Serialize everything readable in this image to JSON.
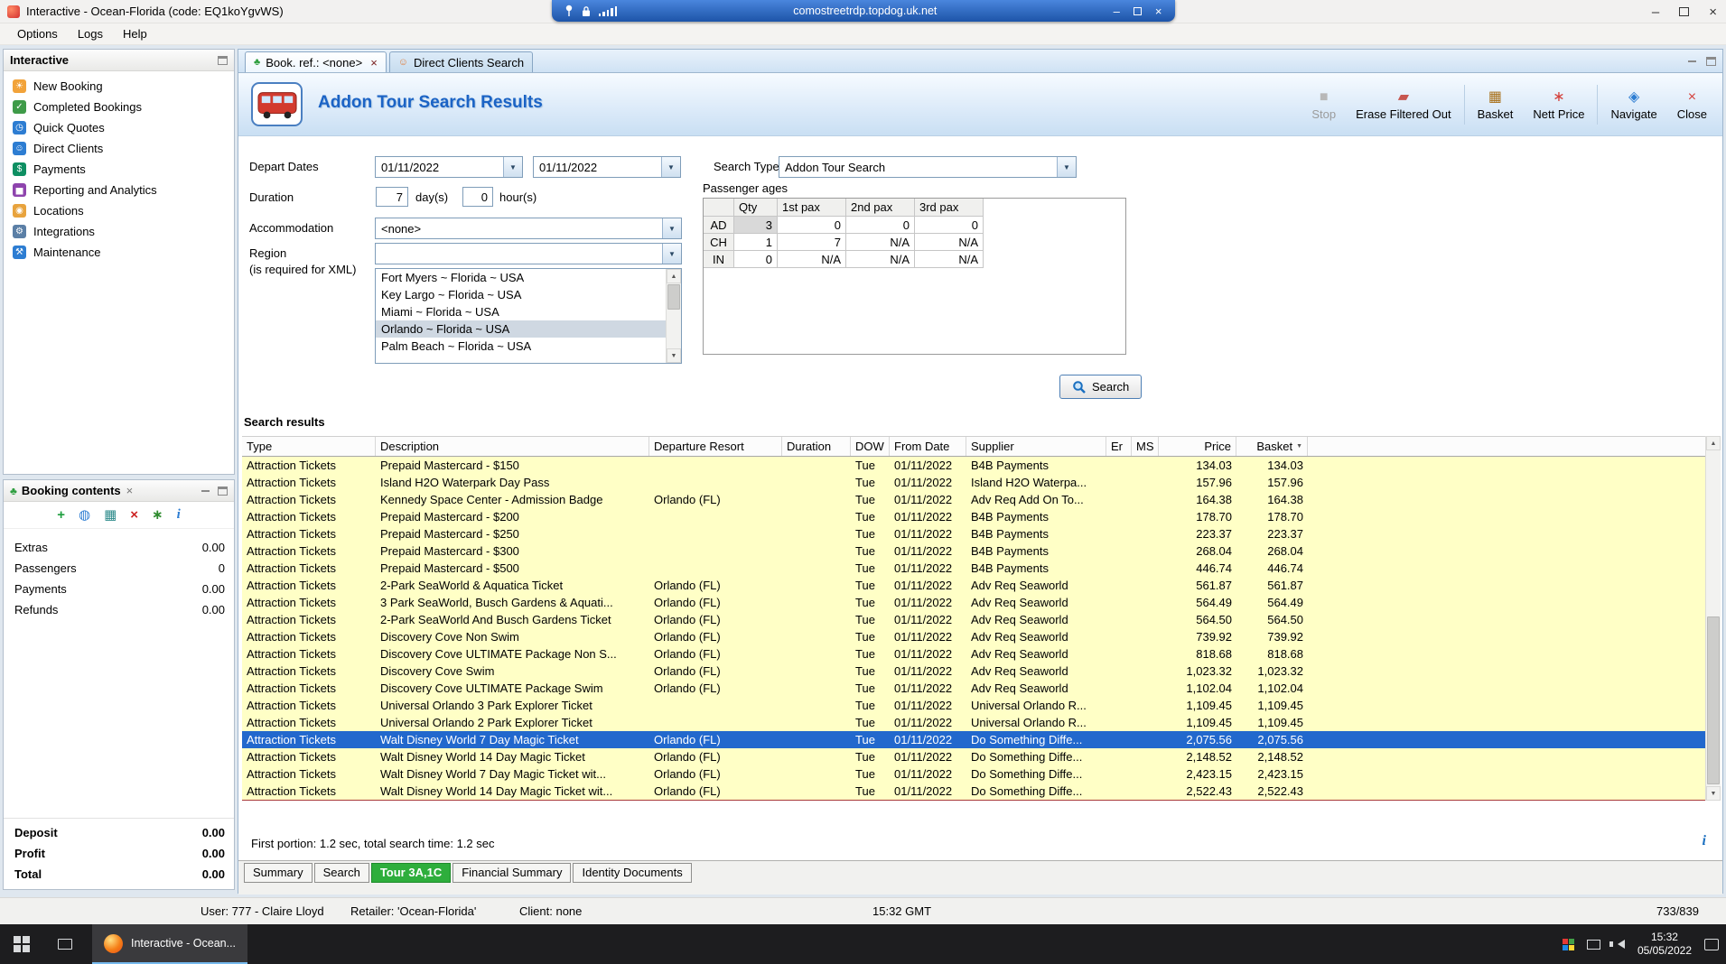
{
  "rdp_bar": {
    "host": "comostreetrdp.topdog.uk.net"
  },
  "window": {
    "title": "Interactive - Ocean-Florida (code: EQ1koYgvWS)"
  },
  "menu": {
    "items": [
      "Options",
      "Logs",
      "Help"
    ]
  },
  "sidebar": {
    "title": "Interactive",
    "items": [
      {
        "label": "New Booking",
        "icon": "new-booking-icon",
        "glyph": "☀",
        "color": "#f2a33a"
      },
      {
        "label": "Completed Bookings",
        "icon": "completed-bookings-icon",
        "glyph": "✓",
        "color": "#3f9b49"
      },
      {
        "label": "Quick Quotes",
        "icon": "quick-quotes-icon",
        "glyph": "◷",
        "color": "#2d7dd2"
      },
      {
        "label": "Direct Clients",
        "icon": "direct-clients-icon",
        "glyph": "☺",
        "color": "#2d7dd2"
      },
      {
        "label": "Payments",
        "icon": "payments-icon",
        "glyph": "$",
        "color": "#0e8f62"
      },
      {
        "label": "Reporting and Analytics",
        "icon": "reporting-analytics-icon",
        "glyph": "▅",
        "color": "#8e44ad"
      },
      {
        "label": "Locations",
        "icon": "locations-icon",
        "glyph": "◉",
        "color": "#e8a33d"
      },
      {
        "label": "Integrations",
        "icon": "integrations-icon",
        "glyph": "⚙",
        "color": "#5b7fa6"
      },
      {
        "label": "Maintenance",
        "icon": "maintenance-icon",
        "glyph": "⚒",
        "color": "#2d7dd2"
      }
    ]
  },
  "booking_contents": {
    "title": "Booking contents",
    "toolbar": [
      {
        "icon": "add-icon",
        "glyph": "+",
        "color": "#1e9e3e"
      },
      {
        "icon": "globe-icon",
        "glyph": "◍",
        "color": "#2d7dd2"
      },
      {
        "icon": "grid-add-icon",
        "glyph": "▦",
        "color": "#2e8b8b"
      },
      {
        "icon": "delete-icon",
        "glyph": "×",
        "color": "#cc2222"
      },
      {
        "icon": "palm-icon",
        "glyph": "∗",
        "color": "#2e8b2e"
      },
      {
        "icon": "info-icon",
        "glyph": "i",
        "color": "#2d7dd2"
      }
    ],
    "rows": [
      {
        "label": "Extras",
        "value": "0.00"
      },
      {
        "label": "Passengers",
        "value": "0"
      },
      {
        "label": "Payments",
        "value": "0.00"
      },
      {
        "label": "Refunds",
        "value": "0.00"
      }
    ],
    "totals": [
      {
        "label": "Deposit",
        "value": "0.00"
      },
      {
        "label": "Profit",
        "value": "0.00"
      },
      {
        "label": "Total",
        "value": "0.00"
      }
    ]
  },
  "doc_tabs": [
    {
      "label": "Book. ref.: <none>",
      "icon": "palm-icon",
      "glyph": "♣",
      "glyph_color": "#2e9e3e",
      "active": true,
      "closable": true
    },
    {
      "label": "Direct Clients Search",
      "icon": "person-search-icon",
      "glyph": "☺",
      "glyph_color": "#e07b39",
      "active": false,
      "closable": false
    }
  ],
  "header": {
    "title": "Addon Tour Search Results",
    "toolbar": [
      {
        "label": "Stop",
        "icon": "stop-icon",
        "glyph": "■",
        "color": "#b8b8b8",
        "disabled": true
      },
      {
        "label": "Erase Filtered Out",
        "icon": "eraser-icon",
        "glyph": "▰",
        "color": "#c7564f",
        "disabled": false
      },
      {
        "label": "Basket",
        "icon": "basket-icon",
        "glyph": "▦",
        "color": "#a8701a",
        "disabled": false
      },
      {
        "label": "Nett Price",
        "icon": "nett-price-icon",
        "glyph": "∗",
        "color": "#d43f3a",
        "disabled": false
      },
      {
        "label": "Navigate",
        "icon": "navigate-icon",
        "glyph": "◈",
        "color": "#2d7dd2",
        "disabled": false
      },
      {
        "label": "Close",
        "icon": "close-icon",
        "glyph": "×",
        "color": "#d43f3a",
        "disabled": false
      }
    ]
  },
  "form": {
    "depart_dates_label": "Depart Dates",
    "depart_date_1": "01/11/2022",
    "depart_date_2": "01/11/2022",
    "duration_label": "Duration",
    "duration_days": "7",
    "duration_days_suffix": "day(s)",
    "duration_hours": "0",
    "duration_hours_suffix": "hour(s)",
    "accommodation_label": "Accommodation",
    "accommodation_value": "<none>",
    "region_label": "Region",
    "region_note": "(is required for XML)",
    "region_value": "",
    "region_options": [
      "Fort Myers ~ Florida ~ USA",
      "Key Largo ~ Florida ~ USA",
      "Miami ~ Florida ~ USA",
      "Orlando ~ Florida ~ USA",
      "Palm Beach ~ Florida ~ USA"
    ],
    "region_selected_index": 3,
    "search_type_label": "Search Type",
    "search_type_value": "Addon Tour Search",
    "passenger_ages_label": "Passenger ages",
    "passenger_table": {
      "headers": [
        "",
        "Qty",
        "1st pax",
        "2nd pax",
        "3rd pax"
      ],
      "rows": [
        [
          "AD",
          "3",
          "0",
          "0",
          "0"
        ],
        [
          "CH",
          "1",
          "7",
          "N/A",
          "N/A"
        ],
        [
          "IN",
          "0",
          "N/A",
          "N/A",
          "N/A"
        ]
      ]
    },
    "search_button": "Search"
  },
  "results": {
    "section_label": "Search results",
    "columns": [
      "Type",
      "Description",
      "Departure Resort",
      "Duration",
      "DOW",
      "From Date",
      "Supplier",
      "Er",
      "MS",
      "Price",
      "Basket"
    ],
    "selected_index": 16,
    "rows": [
      [
        "Attraction Tickets",
        "Prepaid Mastercard - $150",
        "",
        "",
        "Tue",
        "01/11/2022",
        "B4B Payments",
        "",
        "",
        "134.03",
        "134.03"
      ],
      [
        "Attraction Tickets",
        "Island H2O Waterpark Day Pass",
        "",
        "",
        "Tue",
        "01/11/2022",
        "Island H2O Waterpa...",
        "",
        "",
        "157.96",
        "157.96"
      ],
      [
        "Attraction Tickets",
        "Kennedy Space Center - Admission Badge",
        "Orlando (FL)",
        "",
        "Tue",
        "01/11/2022",
        "Adv Req Add On To...",
        "",
        "",
        "164.38",
        "164.38"
      ],
      [
        "Attraction Tickets",
        "Prepaid Mastercard - $200",
        "",
        "",
        "Tue",
        "01/11/2022",
        "B4B Payments",
        "",
        "",
        "178.70",
        "178.70"
      ],
      [
        "Attraction Tickets",
        "Prepaid Mastercard - $250",
        "",
        "",
        "Tue",
        "01/11/2022",
        "B4B Payments",
        "",
        "",
        "223.37",
        "223.37"
      ],
      [
        "Attraction Tickets",
        "Prepaid Mastercard - $300",
        "",
        "",
        "Tue",
        "01/11/2022",
        "B4B Payments",
        "",
        "",
        "268.04",
        "268.04"
      ],
      [
        "Attraction Tickets",
        "Prepaid Mastercard - $500",
        "",
        "",
        "Tue",
        "01/11/2022",
        "B4B Payments",
        "",
        "",
        "446.74",
        "446.74"
      ],
      [
        "Attraction Tickets",
        "2-Park SeaWorld & Aquatica Ticket",
        "Orlando (FL)",
        "",
        "Tue",
        "01/11/2022",
        "Adv Req Seaworld",
        "",
        "",
        "561.87",
        "561.87"
      ],
      [
        "Attraction Tickets",
        "3 Park SeaWorld, Busch Gardens & Aquati...",
        "Orlando (FL)",
        "",
        "Tue",
        "01/11/2022",
        "Adv Req Seaworld",
        "",
        "",
        "564.49",
        "564.49"
      ],
      [
        "Attraction Tickets",
        "2-Park SeaWorld And Busch Gardens Ticket",
        "Orlando (FL)",
        "",
        "Tue",
        "01/11/2022",
        "Adv Req Seaworld",
        "",
        "",
        "564.50",
        "564.50"
      ],
      [
        "Attraction Tickets",
        "Discovery Cove Non Swim",
        "Orlando (FL)",
        "",
        "Tue",
        "01/11/2022",
        "Adv Req Seaworld",
        "",
        "",
        "739.92",
        "739.92"
      ],
      [
        "Attraction Tickets",
        "Discovery Cove ULTIMATE Package Non S...",
        "Orlando (FL)",
        "",
        "Tue",
        "01/11/2022",
        "Adv Req Seaworld",
        "",
        "",
        "818.68",
        "818.68"
      ],
      [
        "Attraction Tickets",
        "Discovery Cove Swim",
        "Orlando (FL)",
        "",
        "Tue",
        "01/11/2022",
        "Adv Req Seaworld",
        "",
        "",
        "1,023.32",
        "1,023.32"
      ],
      [
        "Attraction Tickets",
        "Discovery Cove ULTIMATE Package Swim",
        "Orlando (FL)",
        "",
        "Tue",
        "01/11/2022",
        "Adv Req Seaworld",
        "",
        "",
        "1,102.04",
        "1,102.04"
      ],
      [
        "Attraction Tickets",
        "Universal Orlando 3 Park Explorer Ticket",
        "",
        "",
        "Tue",
        "01/11/2022",
        "Universal Orlando R...",
        "",
        "",
        "1,109.45",
        "1,109.45"
      ],
      [
        "Attraction Tickets",
        "Universal Orlando 2 Park Explorer Ticket",
        "",
        "",
        "Tue",
        "01/11/2022",
        "Universal Orlando R...",
        "",
        "",
        "1,109.45",
        "1,109.45"
      ],
      [
        "Attraction Tickets",
        "Walt Disney World 7 Day Magic Ticket",
        "Orlando (FL)",
        "",
        "Tue",
        "01/11/2022",
        "Do Something Diffe...",
        "",
        "",
        "2,075.56",
        "2,075.56"
      ],
      [
        "Attraction Tickets",
        "Walt Disney World 14 Day Magic Ticket",
        "Orlando (FL)",
        "",
        "Tue",
        "01/11/2022",
        "Do Something Diffe...",
        "",
        "",
        "2,148.52",
        "2,148.52"
      ],
      [
        "Attraction Tickets",
        "Walt Disney World 7 Day Magic Ticket wit...",
        "Orlando (FL)",
        "",
        "Tue",
        "01/11/2022",
        "Do Something Diffe...",
        "",
        "",
        "2,423.15",
        "2,423.15"
      ],
      [
        "Attraction Tickets",
        "Walt Disney World 14 Day Magic Ticket wit...",
        "Orlando (FL)",
        "",
        "Tue",
        "01/11/2022",
        "Do Something Diffe...",
        "",
        "",
        "2,522.43",
        "2,522.43"
      ]
    ],
    "status": "First portion: 1.2 sec, total search time: 1.2 sec"
  },
  "bottom_tabs": {
    "items": [
      "Summary",
      "Search",
      "Tour 3A,1C",
      "Financial Summary",
      "Identity Documents"
    ],
    "active_index": 2
  },
  "status_bar": {
    "user": "User: 777 - Claire Lloyd",
    "retailer": "Retailer: 'Ocean-Florida'",
    "client": "Client: none",
    "time": "15:32 GMT",
    "pages": "733/839"
  },
  "taskbar": {
    "app": "Interactive - Ocean...",
    "time": "15:32",
    "date": "05/05/2022"
  }
}
